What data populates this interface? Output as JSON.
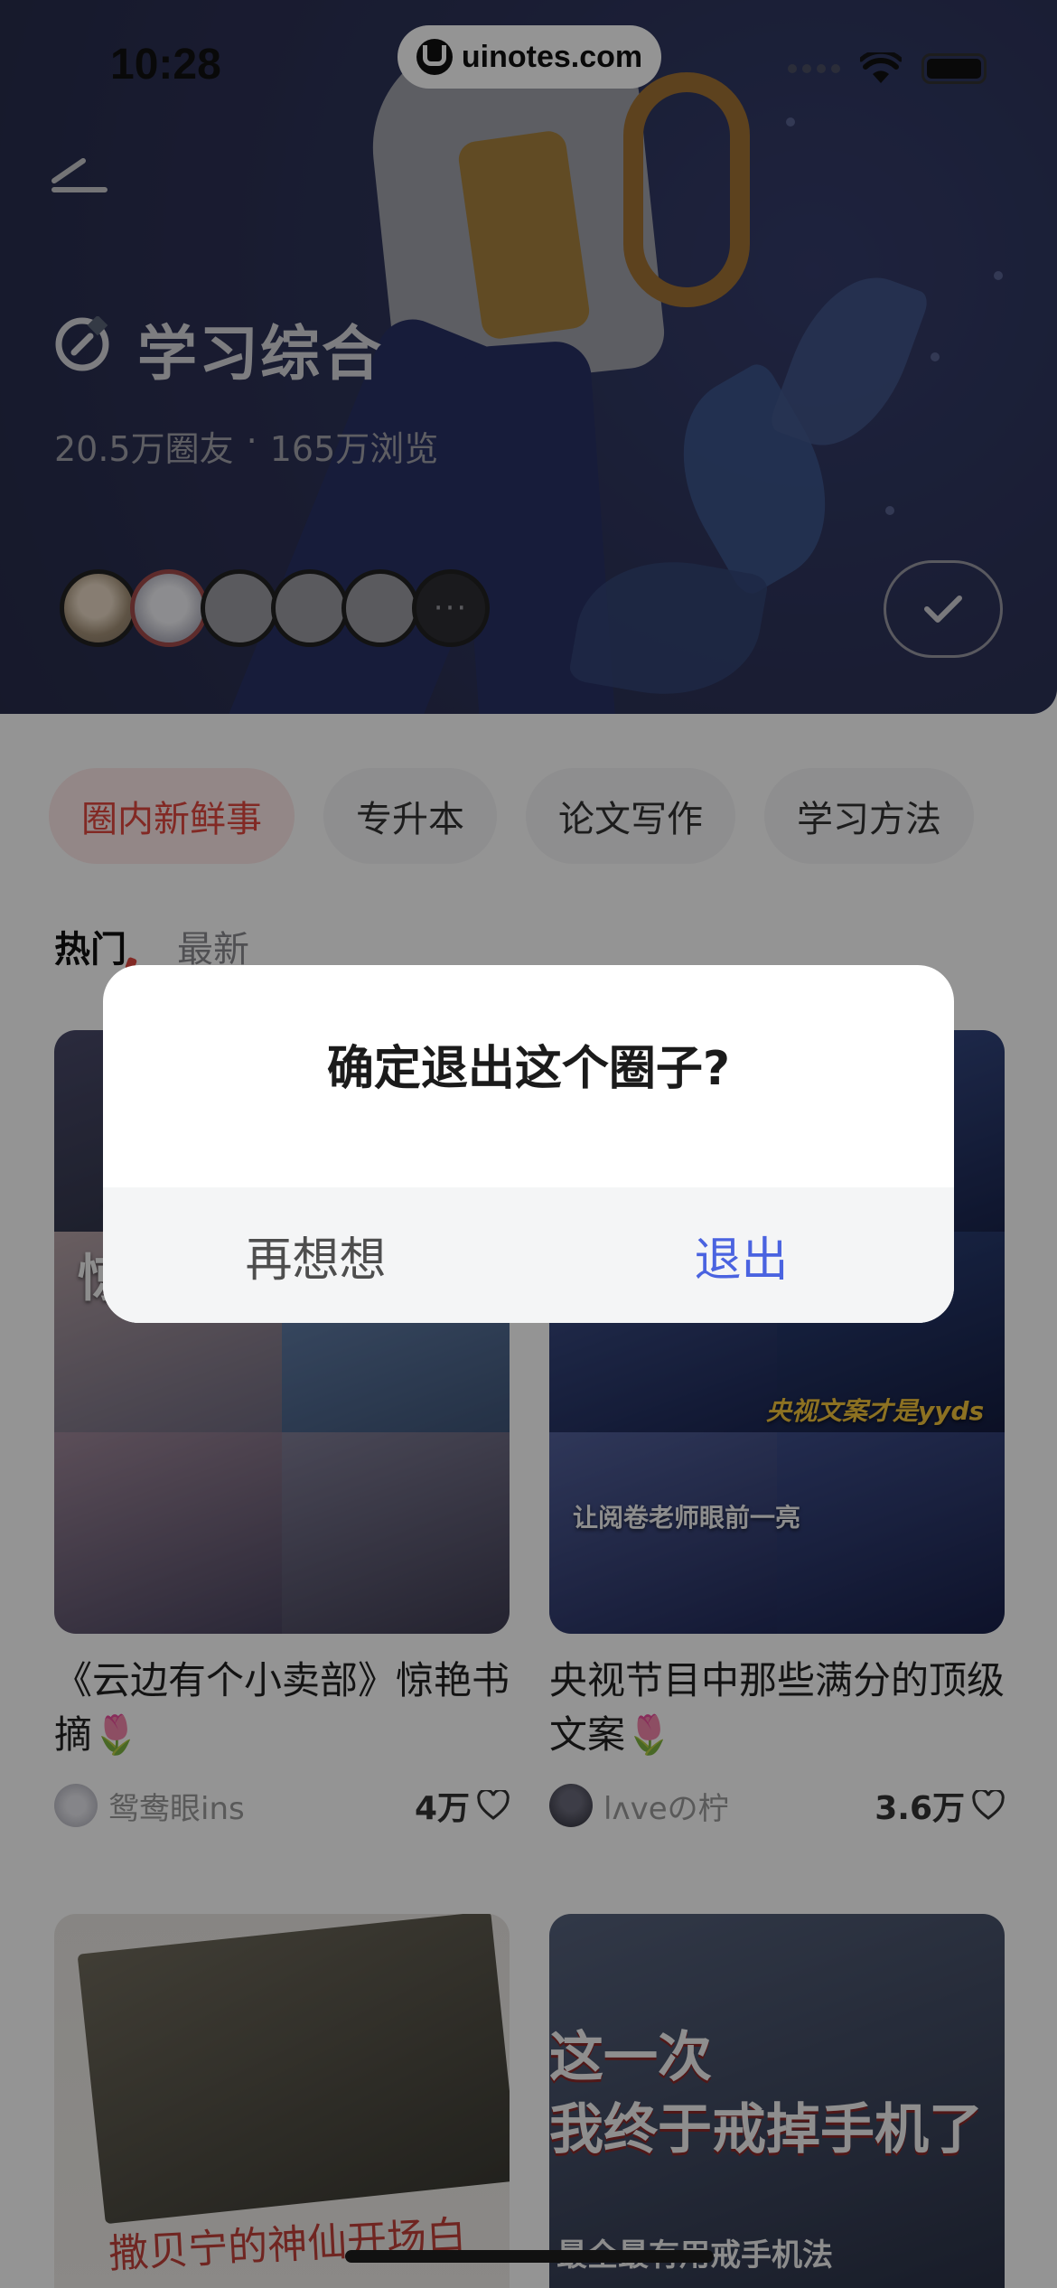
{
  "status_bar": {
    "time": "10:28"
  },
  "watermark": {
    "text": "uinotes.com"
  },
  "circle": {
    "title": "学习综合",
    "members": "20.5万圈友",
    "separator": "·",
    "views": "165万浏览",
    "more_avatars": "···"
  },
  "chips": [
    "圈内新鲜事",
    "专升本",
    "论文写作",
    "学习方法"
  ],
  "tabs": {
    "hot": "热门",
    "latest": "最新"
  },
  "cards": [
    {
      "title": "《云边有个小卖部》惊艳书摘🌷",
      "author": "鸳鸯眼ins",
      "likes": "4万",
      "thumb_captions": [
        "《",
        "惊"
      ]
    },
    {
      "title": "央视节目中那些满分的顶级文案🌷",
      "author": "lʌveの柠",
      "likes": "3.6万",
      "thumb_captions": [
        "央视文案才是yyds",
        "让阅卷老师眼前一亮"
      ]
    },
    {
      "thumb_captions": [
        "撒贝宁的神仙开场白"
      ]
    },
    {
      "thumb_captions": [
        "这一次",
        "我终于戒掉手机了",
        "最全最有用戒手机法"
      ]
    }
  ],
  "dialog": {
    "title": "确定退出这个圈子?",
    "cancel": "再想想",
    "confirm": "退出"
  },
  "colors": {
    "accent_red": "#e0473f",
    "confirm_blue": "#4a63e0",
    "hero_navy": "#232d67"
  }
}
